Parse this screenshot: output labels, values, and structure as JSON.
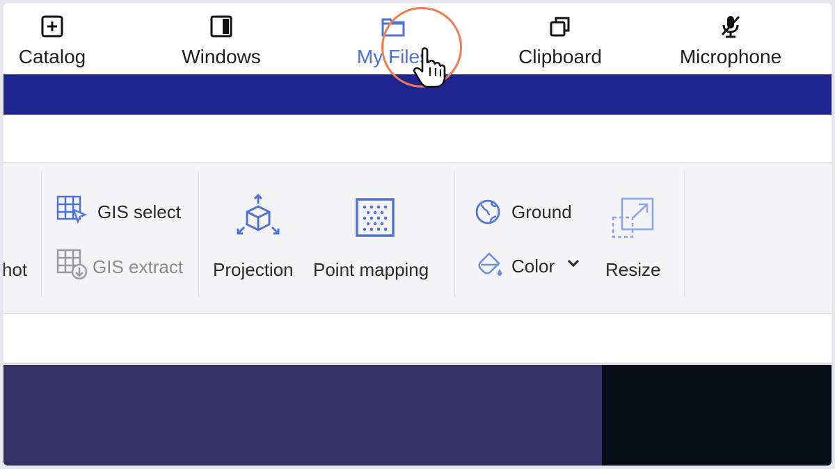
{
  "toolbar": {
    "items": [
      {
        "label": "Catalog",
        "icon": "plus-square-icon"
      },
      {
        "label": "Windows",
        "icon": "window-panel-icon"
      },
      {
        "label": "My Files",
        "icon": "folder-icon",
        "active": true
      },
      {
        "label": "Clipboard",
        "icon": "copy-icon"
      },
      {
        "label": "Microphone",
        "icon": "microphone-muted-icon"
      }
    ]
  },
  "ribbon": {
    "partial_label": "hot",
    "gis_select": "GIS select",
    "gis_extract": "GIS extract",
    "projection": "Projection",
    "point_mapping": "Point mapping",
    "ground": "Ground",
    "color": "Color",
    "resize": "Resize"
  },
  "colors": {
    "accent": "#4d74d6",
    "band": "#1f2491",
    "highlight": "#f47a4f",
    "panel_left": "#333163",
    "panel_right": "#060d16"
  }
}
